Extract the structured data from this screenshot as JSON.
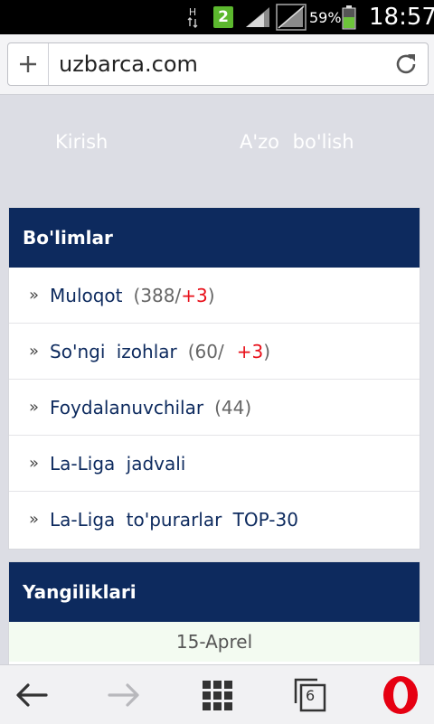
{
  "status_bar": {
    "network_type": "H",
    "notification_count": "2",
    "battery_percent": "59%",
    "time": "18:57",
    "icons": [
      "signal-icon",
      "no-data-signal-icon",
      "battery-icon"
    ]
  },
  "address_bar": {
    "url": "uzbarca.com",
    "icons": [
      "add-icon",
      "reload-icon"
    ]
  },
  "auth": {
    "login_label": "Kirish",
    "register_label": "A'zo bo'lish"
  },
  "sections": {
    "title": "Bo'limlar",
    "bullet": "»",
    "items": [
      {
        "label": "Muloqot",
        "count": "(388/",
        "new": "+3",
        "close": ")"
      },
      {
        "label": "So'ngi izohlar",
        "count": "(60/",
        "new": "+3",
        "close": ")"
      },
      {
        "label": "Foydalanuvchilar",
        "count": "(44)"
      },
      {
        "label": "La-Liga jadvali"
      },
      {
        "label": "La-Liga to'purarlar TOP-30"
      }
    ]
  },
  "news": {
    "title": "Yangiliklari",
    "date": "15-Aprel"
  },
  "bottom_bar": {
    "tabs_count": "6",
    "icons": [
      "back-arrow-icon",
      "forward-arrow-icon",
      "speed-dial-icon",
      "tabs-icon",
      "opera-logo-icon"
    ]
  },
  "colors": {
    "header_navy": "#0d2a5e",
    "link_navy": "#0d2a5e",
    "new_count_red": "#e8101a",
    "page_background": "#dcdde4",
    "date_background": "#f3fbf1"
  }
}
